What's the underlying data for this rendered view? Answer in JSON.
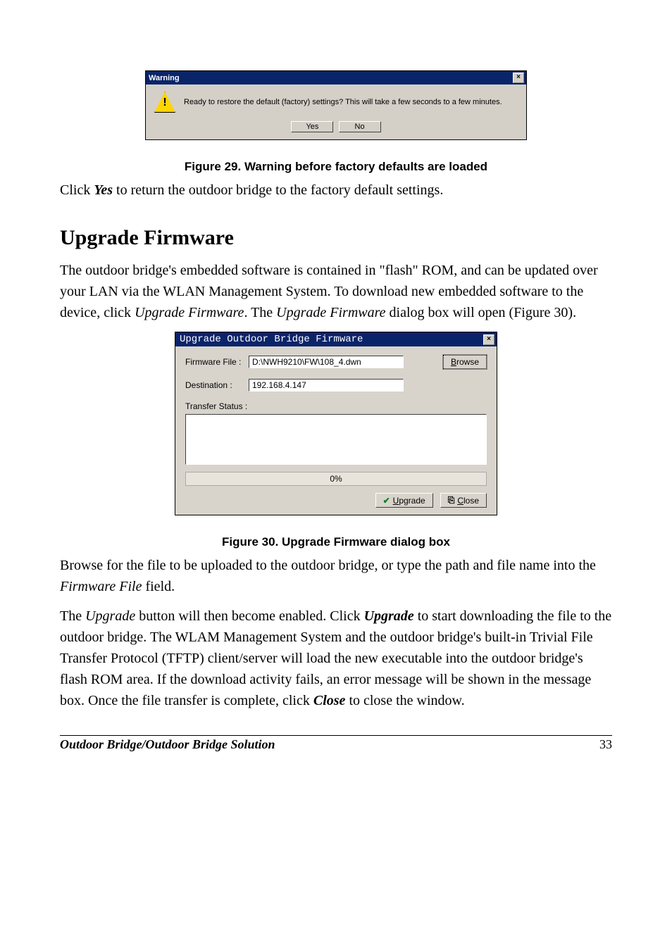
{
  "warning_dialog": {
    "title": "Warning",
    "close_glyph": "×",
    "message": "Ready to restore the default (factory) settings? This will take a few seconds to a few minutes.",
    "yes_label": "Yes",
    "no_label": "No"
  },
  "figure29_caption": "Figure 29.  Warning before factory defaults are loaded",
  "para_click_yes_prefix": "Click ",
  "para_click_yes_em": "Yes",
  "para_click_yes_suffix": " to return the outdoor bridge to the factory default settings.",
  "section_heading": "Upgrade Firmware",
  "para_intro_1": "The outdoor bridge's embedded software is contained in \"flash\" ROM, and can be updated over your LAN via the WLAN Management System. To download new embedded software to the device, click ",
  "para_intro_em1": "Upgrade Firmware",
  "para_intro_2": ". The ",
  "para_intro_em2": "Upgrade Firmware",
  "para_intro_3": " dialog box will open (Figure 30).",
  "upgrade_dialog": {
    "title": "Upgrade Outdoor Bridge Firmware",
    "close_glyph": "×",
    "firmware_label": "Firmware File :",
    "firmware_value": "D:\\NWH9210\\FW\\108_4.dwn",
    "browse_u": "B",
    "browse_rest": "rowse",
    "destination_label": "Destination :",
    "destination_value": "192.168.4.147",
    "transfer_label": "Transfer Status :",
    "progress_text": "0%",
    "upgrade_u": "U",
    "upgrade_rest": "pgrade",
    "close_u": "C",
    "close_rest": "lose"
  },
  "figure30_caption": "Figure 30.  Upgrade Firmware dialog box",
  "para_browse_1": "Browse for the file to be uploaded to the outdoor bridge, or type the path and file name into the ",
  "para_browse_em": "Firmware File",
  "para_browse_2": " field.",
  "para_upgrade_1": "The ",
  "para_upgrade_em1": "Upgrade",
  "para_upgrade_2": " button will then become enabled. Click ",
  "para_upgrade_strong": "Upgrade",
  "para_upgrade_3": " to start downloading the file to the outdoor bridge. The WLAM Management System and the outdoor bridge's built-in Trivial File Transfer Protocol (TFTP) client/server will load the new executable into the outdoor bridge's flash ROM area. If the download activity fails, an error message will be shown in the message box. Once the file transfer is complete, click ",
  "para_upgrade_strong2": "Close",
  "para_upgrade_4": " to close the window.",
  "footer_left": "Outdoor Bridge/Outdoor Bridge Solution",
  "footer_right": "33"
}
